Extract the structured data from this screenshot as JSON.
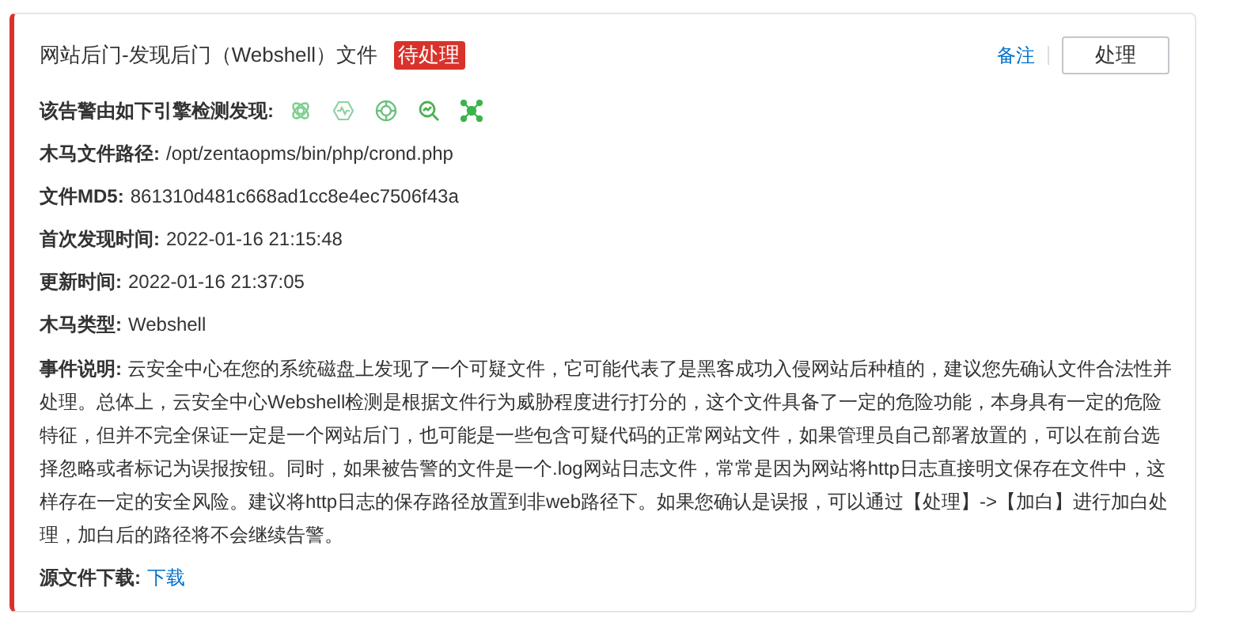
{
  "alert": {
    "title": "网站后门-发现后门（Webshell）文件",
    "status": "待处理",
    "actions": {
      "note_link": "备注",
      "handle_button": "处理"
    },
    "engines_label": "该告警由如下引擎检测发现:",
    "fields": [
      {
        "label": "木马文件路径:",
        "value": "/opt/zentaopms/bin/php/crond.php"
      },
      {
        "label": "文件MD5:",
        "value": "861310d481c668ad1cc8e4ec7506f43a"
      },
      {
        "label": "首次发现时间:",
        "value": "2022-01-16 21:15:48"
      },
      {
        "label": "更新时间:",
        "value": "2022-01-16 21:37:05"
      },
      {
        "label": "木马类型:",
        "value": "Webshell"
      }
    ],
    "description": "**事件说明:** 云安全中心在您的系统磁盘上发现了一个可疑文件，它可能代表了是黑客成功入侵网站后种植的，建议您先确认文件合法性并处理。总体上，云安全中心Webshell检测是根据文件行为威胁程度进行打分的，这个文件具备了一定的危险功能，本身具有一定的危险特征，但并不完全保证一定是一个网站后门，也可能是一些包含可疑代码的正常网站文件，如果管理员自己部署放置的，可以在前台选择忽略或者标记为误报按钮。同时，如果被告警的文件是一个.log网站日志文件，常常是因为网站将http日志直接明文保存在文件中，这样存在一定的安全风险。建议将http日志的保存路径放置到非web路径下。如果您确认是误报，可以通过【处理】->【加白】进行加白处理，加白后的路径将不会继续告警。",
    "download": {
      "label": "源文件下载:",
      "link": "下载"
    }
  }
}
